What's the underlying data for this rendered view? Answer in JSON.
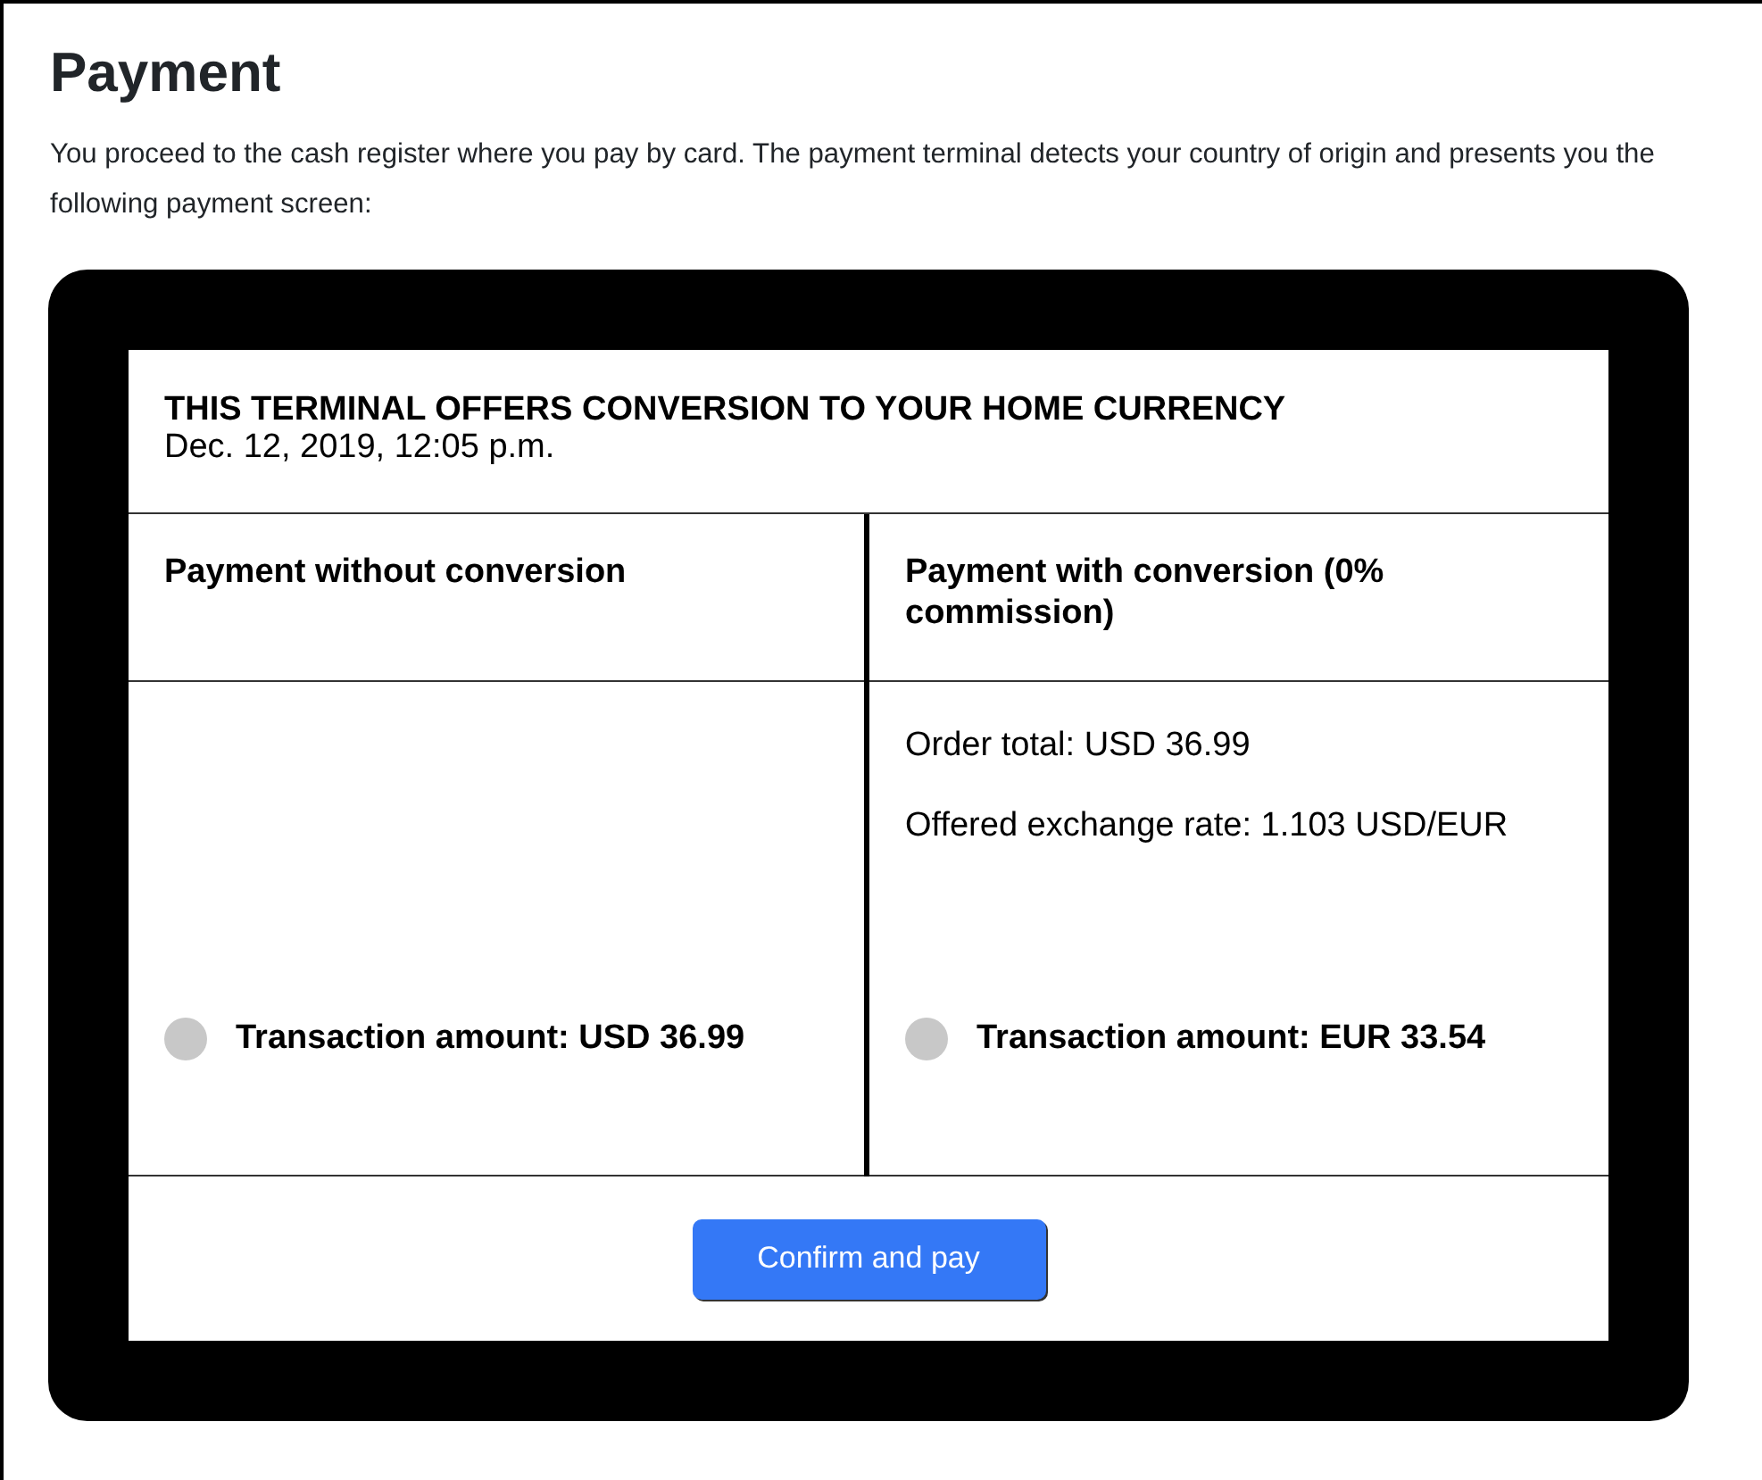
{
  "title": "Payment",
  "intro": "You proceed to the cash register where you pay by card. The payment terminal detects your country of origin and presents you the following payment screen:",
  "terminal": {
    "title": "THIS TERMINAL OFFERS CONVERSION TO YOUR HOME CURRENCY",
    "date": "Dec. 12, 2019, 12:05 p.m.",
    "options": [
      {
        "heading": "Payment without conversion",
        "amount": "Transaction amount: USD 36.99",
        "selected": false
      },
      {
        "heading": "Payment with conversion (0% commission)",
        "details": [
          "Order total: USD 36.99",
          "Offered exchange rate: 1.103 USD/EUR"
        ],
        "amount": "Transaction amount: EUR 33.54",
        "selected": false
      }
    ],
    "button": "Confirm and pay"
  }
}
